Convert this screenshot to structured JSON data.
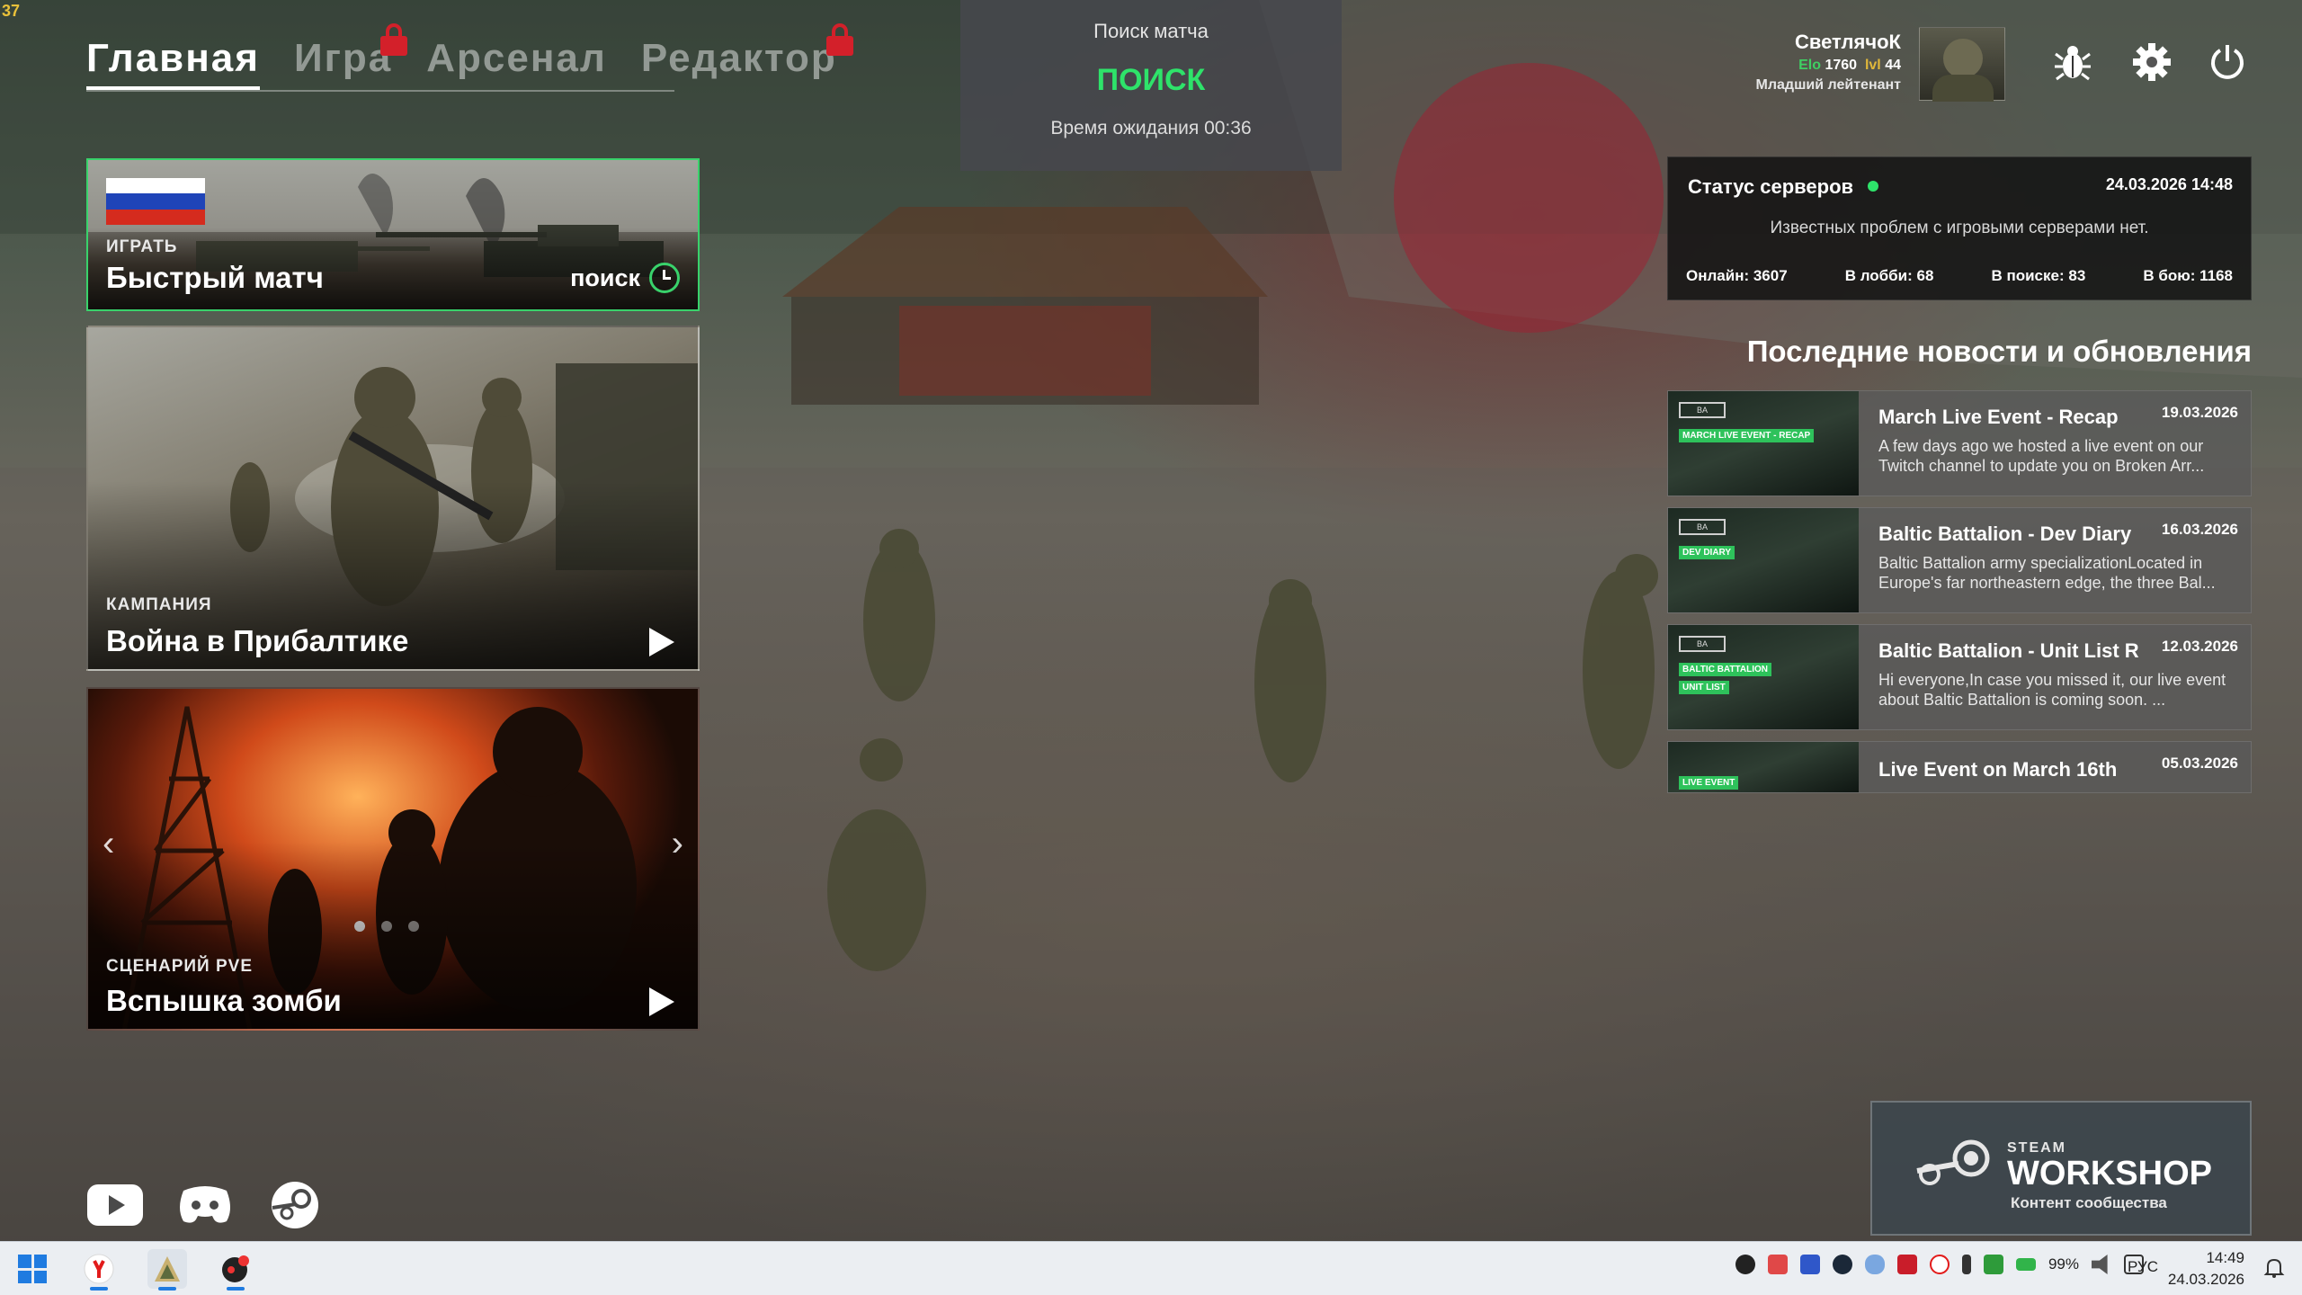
{
  "fps": "37",
  "nav": {
    "tabs": [
      {
        "label": "Главная",
        "active": true,
        "locked": false
      },
      {
        "label": "Игра",
        "active": false,
        "locked": true
      },
      {
        "label": "Арсенал",
        "active": false,
        "locked": false
      },
      {
        "label": "Редактор",
        "active": false,
        "locked": true
      }
    ]
  },
  "search": {
    "title": "Поиск матча",
    "status": "ПОИСК",
    "wait": "Время ожидания 00:36"
  },
  "cards": {
    "quick": {
      "kicker": "ИГРАТЬ",
      "title": "Быстрый матч",
      "search_label": "поиск"
    },
    "campaign": {
      "kicker": "КАМПАНИЯ",
      "title": "Война в Прибалтике"
    },
    "zombie": {
      "kicker": "СЦЕНАРИЙ PVE",
      "title": "Вспышка зомби",
      "dots": 3,
      "active_dot": 0
    }
  },
  "player": {
    "name": "СветлячоК",
    "elo_label": "Elo",
    "elo": "1760",
    "lvl_label": "lvl",
    "lvl": "44",
    "rank": "Младший лейтенант"
  },
  "server": {
    "title": "Статус серверов",
    "datetime": "24.03.2026 14:48",
    "message": "Известных проблем с игровыми серверами нет.",
    "online": "Онлайн: 3607",
    "lobby": "В лобби: 68",
    "searching": "В поиске: 83",
    "in_battle": "В бою: 1168"
  },
  "news": {
    "header": "Последние новости и обновления",
    "items": [
      {
        "title": "March Live Event - Recap",
        "date": "19.03.2026",
        "body": "A few days ago we hosted a live event on our Twitch channel to update you on Broken Arr...",
        "tag": "MARCH LIVE EVENT - RECAP",
        "tag2": ""
      },
      {
        "title": "Baltic Battalion - Dev Diary",
        "date": "16.03.2026",
        "body": "Baltic Battalion army specializationLocated in Europe's far northeastern edge, the three Bal...",
        "tag": "DEV DIARY",
        "tag2": ""
      },
      {
        "title": "Baltic Battalion - Unit List R...",
        "date": "12.03.2026",
        "body": "Hi everyone,In case you missed it, our live event about Baltic Battalion is coming soon. ...",
        "tag": "BALTIC BATTALION",
        "tag2": "UNIT LIST"
      },
      {
        "title": "Live Event on March 16th",
        "date": "05.03.2026",
        "body": "",
        "tag": "LIVE EVENT",
        "tag2": ""
      }
    ]
  },
  "workshop": {
    "steam": "STEAM",
    "title": "WORKSHOP",
    "subtitle": "Контент сообщества"
  },
  "taskbar": {
    "battery": "99%",
    "lang": "РУС",
    "time": "14:49",
    "date": "24.03.2026"
  },
  "colors": {
    "accent_green": "#2ee36a",
    "lock_red": "#d3202a"
  }
}
